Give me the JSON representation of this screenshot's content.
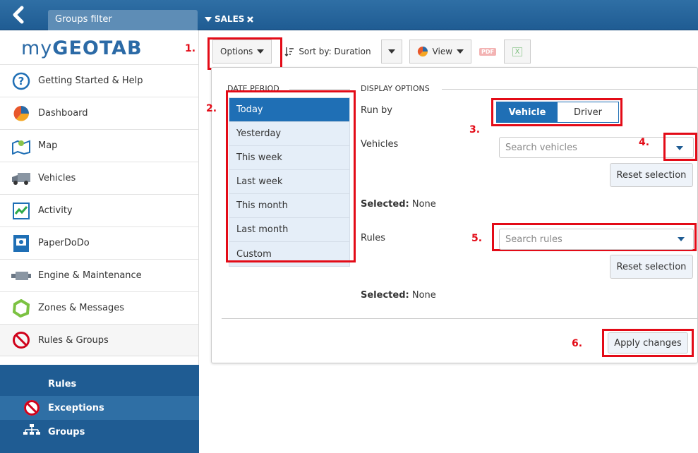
{
  "header": {
    "groups_filter": "Groups filter",
    "sales": "SALES"
  },
  "logo": {
    "prefix": "my",
    "name": "GEOTAB"
  },
  "sidebar": {
    "items": [
      {
        "label": "Getting Started & Help",
        "icon": "help-icon"
      },
      {
        "label": "Dashboard",
        "icon": "pie-chart-icon"
      },
      {
        "label": "Map",
        "icon": "map-icon"
      },
      {
        "label": "Vehicles",
        "icon": "truck-icon"
      },
      {
        "label": "Activity",
        "icon": "activity-icon"
      },
      {
        "label": "PaperDoDo",
        "icon": "document-icon"
      },
      {
        "label": "Engine & Maintenance",
        "icon": "engine-icon"
      },
      {
        "label": "Zones & Messages",
        "icon": "zone-icon"
      },
      {
        "label": "Rules & Groups",
        "icon": "no-entry-icon"
      }
    ],
    "sub": [
      {
        "label": "Rules"
      },
      {
        "label": "Exceptions"
      },
      {
        "label": "Groups"
      }
    ]
  },
  "toolbar": {
    "options": "Options",
    "sort": "Sort by: Duration",
    "view": "View",
    "pdf": "PDF",
    "excel": "X"
  },
  "annotations": {
    "a1": "1.",
    "a2": "2.",
    "a3": "3.",
    "a4": "4.",
    "a5": "5.",
    "a6": "6."
  },
  "panel": {
    "date_period_label": "DATE PERIOD",
    "display_options_label": "DISPLAY OPTIONS",
    "dates": [
      "Today",
      "Yesterday",
      "This week",
      "Last week",
      "This month",
      "Last month",
      "Custom"
    ],
    "selected_date": "Today",
    "run_by": "Run by",
    "toggle_vehicle": "Vehicle",
    "toggle_driver": "Driver",
    "vehicles": "Vehicles",
    "search_vehicles_placeholder": "Search vehicles",
    "reset_selection": "Reset selection",
    "selected_label": "Selected:",
    "selected_value": "None",
    "rules": "Rules",
    "search_rules_placeholder": "Search rules",
    "apply": "Apply changes"
  },
  "colors": {
    "accent": "#1f6fb5",
    "header": "#1f5c93",
    "annotation": "#e30b17"
  }
}
